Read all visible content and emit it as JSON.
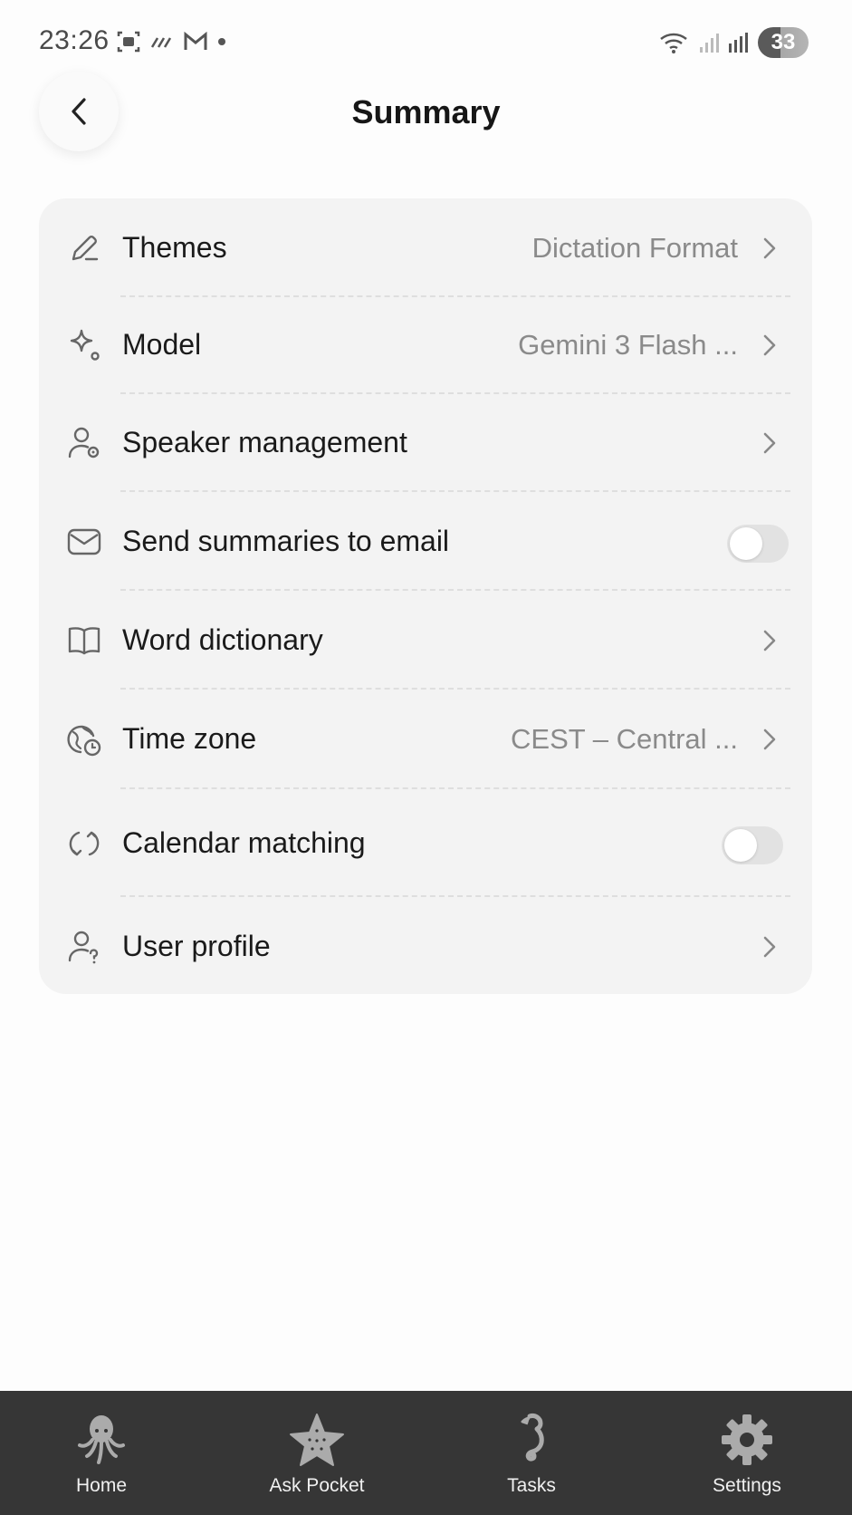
{
  "status_bar": {
    "time": "23:26",
    "battery": "33"
  },
  "header": {
    "title": "Summary"
  },
  "settings": [
    {
      "label": "Themes",
      "value": "Dictation Format",
      "control": "chevron",
      "icon": "pencil-icon"
    },
    {
      "label": "Model",
      "value": "Gemini 3 Flash ...",
      "control": "chevron",
      "icon": "sparkle-icon"
    },
    {
      "label": "Speaker management",
      "value": "",
      "control": "chevron",
      "icon": "user-gear-icon"
    },
    {
      "label": "Send summaries to email",
      "value": "",
      "control": "toggle",
      "enabled": false,
      "icon": "envelope-icon"
    },
    {
      "label": "Word dictionary",
      "value": "",
      "control": "chevron",
      "icon": "book-icon"
    },
    {
      "label": "Time zone",
      "value": "CEST – Central ...",
      "control": "chevron",
      "icon": "globe-clock-icon"
    },
    {
      "label": "Calendar matching",
      "value": "",
      "control": "toggle",
      "enabled": false,
      "icon": "sync-icon"
    },
    {
      "label": "User profile",
      "value": "",
      "control": "chevron",
      "icon": "user-question-icon"
    }
  ],
  "bottom_nav": [
    {
      "label": "Home",
      "icon": "octopus-icon"
    },
    {
      "label": "Ask Pocket",
      "icon": "starfish-icon"
    },
    {
      "label": "Tasks",
      "icon": "seahorse-icon"
    },
    {
      "label": "Settings",
      "icon": "gear-icon"
    }
  ],
  "colors": {
    "card_background": "#f3f3f3",
    "nav_background": "#363636",
    "value_text": "#8a8a8a",
    "toggle_off": "#e2e2e2"
  }
}
